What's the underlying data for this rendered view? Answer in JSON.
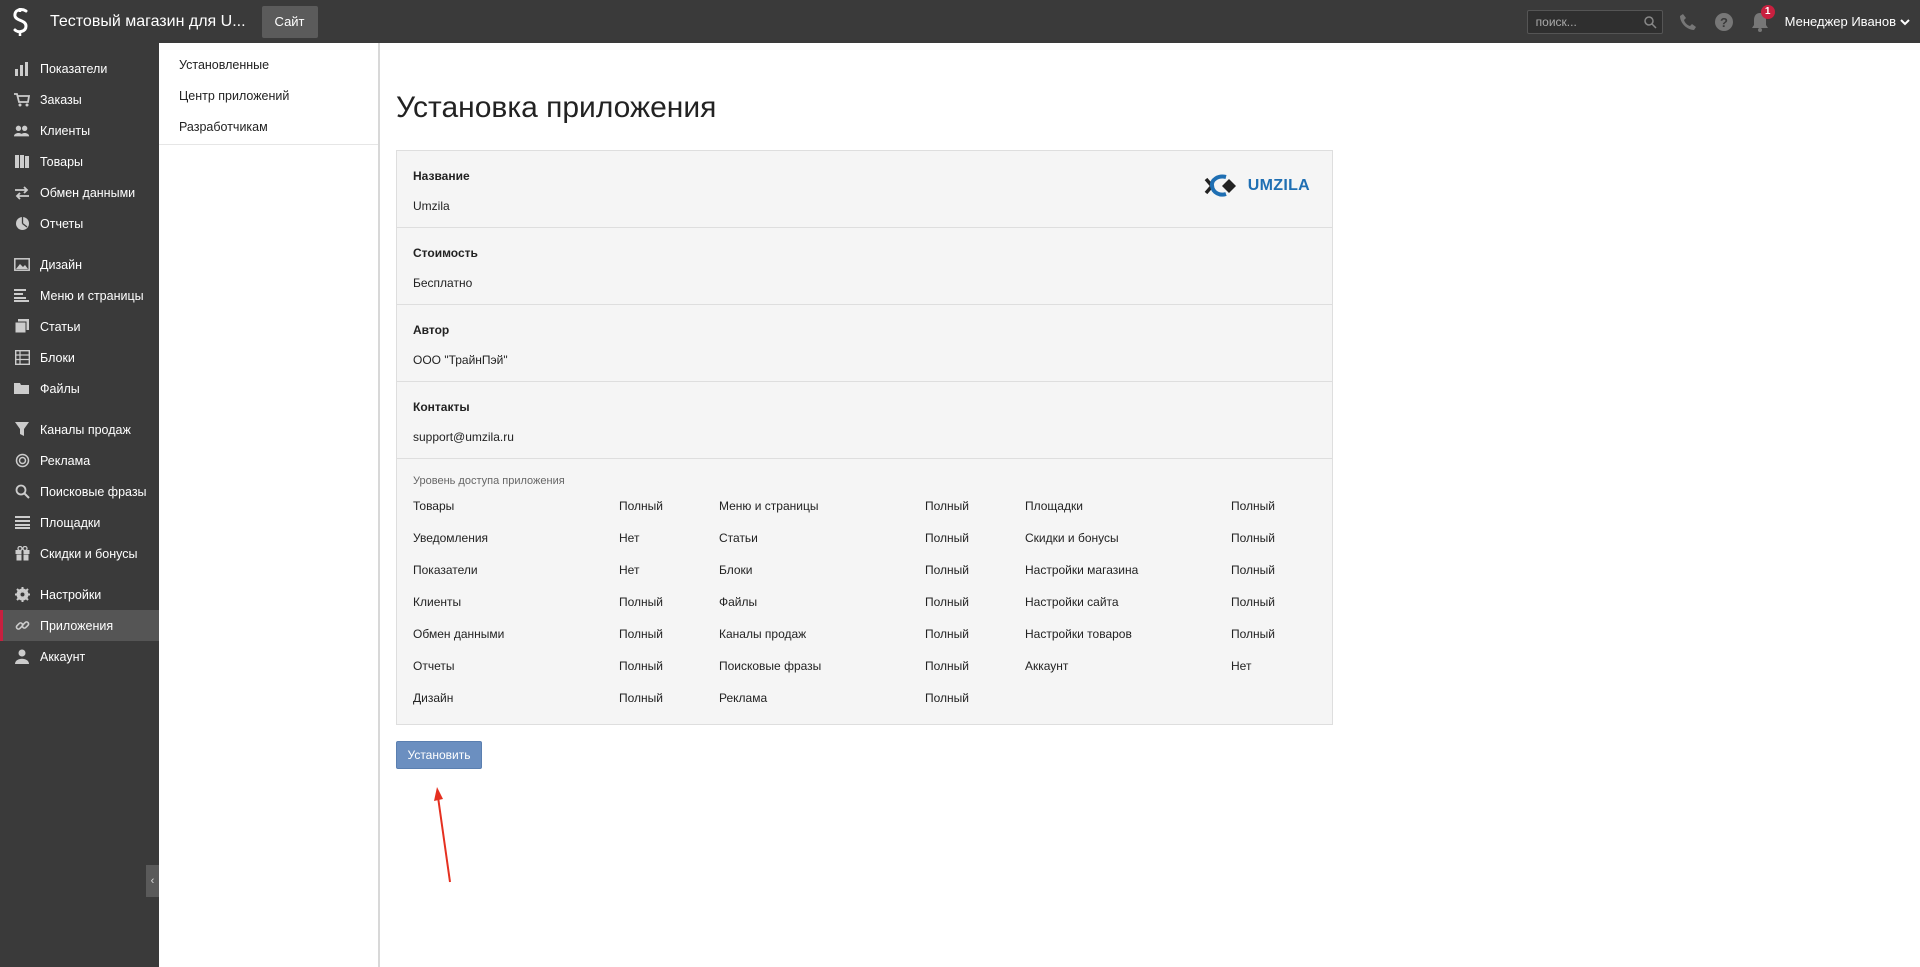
{
  "topbar": {
    "shop_title": "Тестовый магазин для U...",
    "site_button": "Сайт",
    "search_placeholder": "поиск...",
    "notifications_count": "1",
    "user_name": "Менеджер Иванов"
  },
  "sidebar": {
    "items": [
      {
        "label": "Показатели",
        "icon": "bar-chart-icon"
      },
      {
        "label": "Заказы",
        "icon": "cart-icon"
      },
      {
        "label": "Клиенты",
        "icon": "users-icon"
      },
      {
        "label": "Товары",
        "icon": "books-icon"
      },
      {
        "label": "Обмен данными",
        "icon": "exchange-icon"
      },
      {
        "label": "Отчеты",
        "icon": "pie-chart-icon"
      },
      {
        "label": "Дизайн",
        "icon": "image-icon"
      },
      {
        "label": "Меню и страницы",
        "icon": "lines-icon"
      },
      {
        "label": "Статьи",
        "icon": "copy-icon"
      },
      {
        "label": "Блоки",
        "icon": "grid-icon"
      },
      {
        "label": "Файлы",
        "icon": "folder-icon"
      },
      {
        "label": "Каналы продаж",
        "icon": "funnel-icon"
      },
      {
        "label": "Реклама",
        "icon": "target-icon"
      },
      {
        "label": "Поисковые фразы",
        "icon": "search-icon"
      },
      {
        "label": "Площадки",
        "icon": "list-icon"
      },
      {
        "label": "Скидки и бонусы",
        "icon": "gift-icon"
      },
      {
        "label": "Настройки",
        "icon": "gear-icon"
      },
      {
        "label": "Приложения",
        "icon": "link-icon"
      },
      {
        "label": "Аккаунт",
        "icon": "person-icon"
      }
    ]
  },
  "subnav": {
    "items": [
      "Установленные",
      "Центр приложений",
      "Разработчикам"
    ]
  },
  "main": {
    "title": "Установка приложения",
    "fields": [
      {
        "label": "Название",
        "value": "Umzila"
      },
      {
        "label": "Стоимость",
        "value": "Бесплатно"
      },
      {
        "label": "Автор",
        "value": "ООО \"ТрайнПэй\""
      },
      {
        "label": "Контакты",
        "value": "support@umzila.ru"
      }
    ],
    "logo_text": "UMZILA",
    "access_title": "Уровень доступа приложения",
    "access": [
      [
        [
          "Товары",
          "Полный"
        ],
        [
          "Меню и страницы",
          "Полный"
        ],
        [
          "Площадки",
          "Полный"
        ]
      ],
      [
        [
          "Уведомления",
          "Нет"
        ],
        [
          "Статьи",
          "Полный"
        ],
        [
          "Скидки и бонусы",
          "Полный"
        ]
      ],
      [
        [
          "Показатели",
          "Нет"
        ],
        [
          "Блоки",
          "Полный"
        ],
        [
          "Настройки магазина",
          "Полный"
        ]
      ],
      [
        [
          "Клиенты",
          "Полный"
        ],
        [
          "Файлы",
          "Полный"
        ],
        [
          "Настройки сайта",
          "Полный"
        ]
      ],
      [
        [
          "Обмен данными",
          "Полный"
        ],
        [
          "Каналы продаж",
          "Полный"
        ],
        [
          "Настройки товаров",
          "Полный"
        ]
      ],
      [
        [
          "Отчеты",
          "Полный"
        ],
        [
          "Поисковые фразы",
          "Полный"
        ],
        [
          "Аккаунт",
          "Нет"
        ]
      ],
      [
        [
          "Дизайн",
          "Полный"
        ],
        [
          "Реклама",
          "Полный"
        ],
        null
      ]
    ],
    "install_button": "Установить"
  },
  "colors": {
    "topbar_bg": "#3a3a3a",
    "active_accent": "#c8203f",
    "install_button": "#6b8fc0",
    "logo_blue": "#1f6fb3",
    "annotation_arrow": "#e53020"
  }
}
